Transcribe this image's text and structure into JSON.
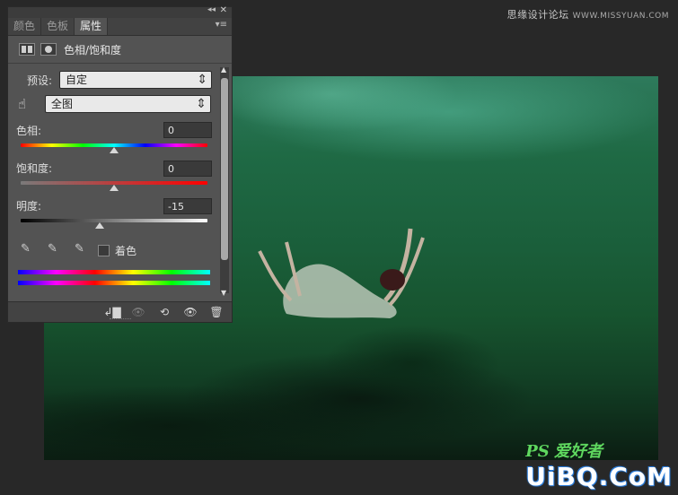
{
  "watermark": {
    "text": "思缘设计论坛",
    "site": "WWW.MISSYUAN.COM"
  },
  "logo": {
    "ps": "PS",
    "cn": "爱好者",
    "big": "UiBQ.CoM"
  },
  "panel": {
    "tabs": [
      {
        "label": "颜色"
      },
      {
        "label": "色板"
      },
      {
        "label": "属性"
      }
    ],
    "collapse_glyph": "◂◂",
    "close_glyph": "✕",
    "menu_glyph": "▾≡",
    "header_title": "色相/饱和度",
    "preset_label": "预设:",
    "preset_value": "自定",
    "range_value": "全图",
    "select_arrows": "⇕",
    "hand_glyph": "☝",
    "hue": {
      "label": "色相:",
      "value": "0",
      "fraction": 0.5
    },
    "saturation": {
      "label": "饱和度:",
      "value": "0",
      "fraction": 0.5
    },
    "lightness": {
      "label": "明度:",
      "value": "-15",
      "fraction": 0.425
    },
    "dropper_glyph": "✎",
    "dropper_plus": "✎",
    "dropper_minus": "✎",
    "colorize_label": "着色",
    "scroll_up": "▲",
    "scroll_down": "▼",
    "footer": {
      "clip": "↲▇",
      "view_previous": "👁",
      "reset": "⟲",
      "visibility": "👁",
      "delete": "🗑"
    }
  }
}
